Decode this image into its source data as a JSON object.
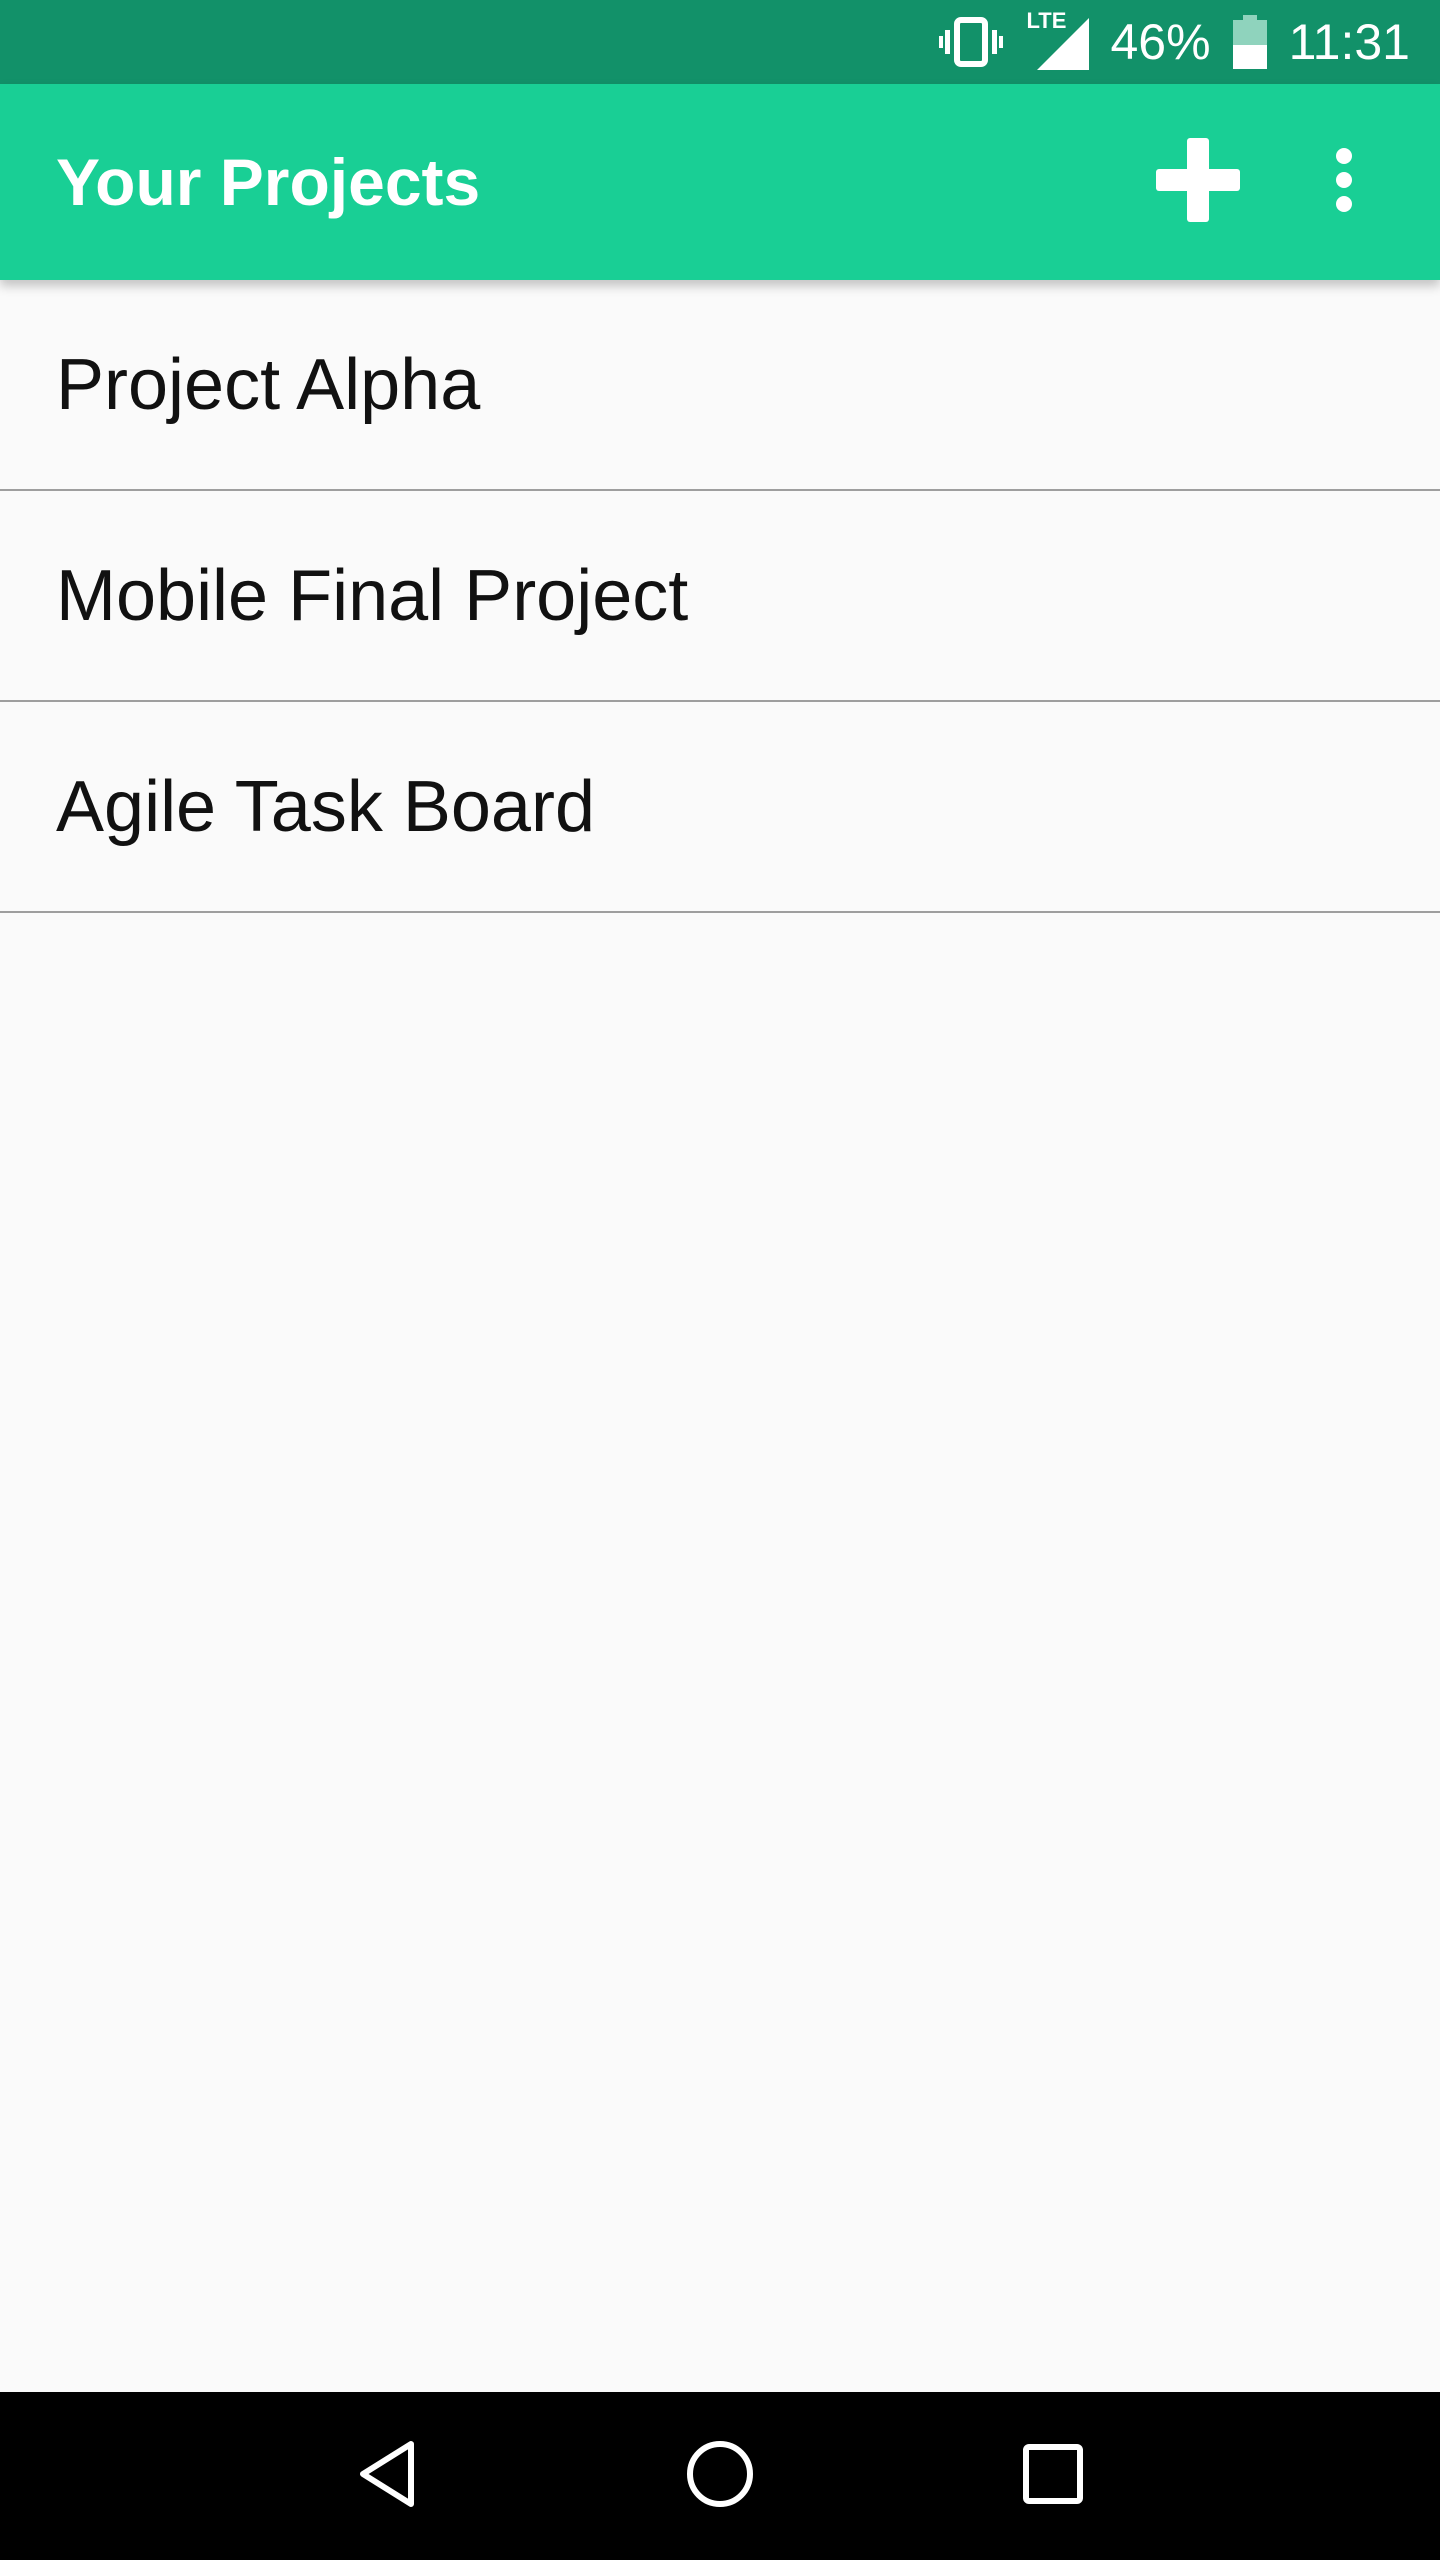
{
  "status_bar": {
    "network": "LTE",
    "battery_percent": "46%",
    "time": "11:31",
    "icons": [
      "vibrate-icon",
      "signal-icon",
      "battery-icon"
    ]
  },
  "app_bar": {
    "title": "Your Projects",
    "actions": [
      "add-icon",
      "overflow-menu-icon"
    ]
  },
  "projects": [
    {
      "name": "Project Alpha"
    },
    {
      "name": "Mobile Final Project"
    },
    {
      "name": "Agile Task Board"
    }
  ],
  "nav_bar": {
    "buttons": [
      "back-icon",
      "home-icon",
      "recents-icon"
    ]
  },
  "colors": {
    "status_bar": "#129169",
    "app_bar": "#19cf95",
    "background": "#fafafa",
    "divider": "#9e9e9e"
  }
}
